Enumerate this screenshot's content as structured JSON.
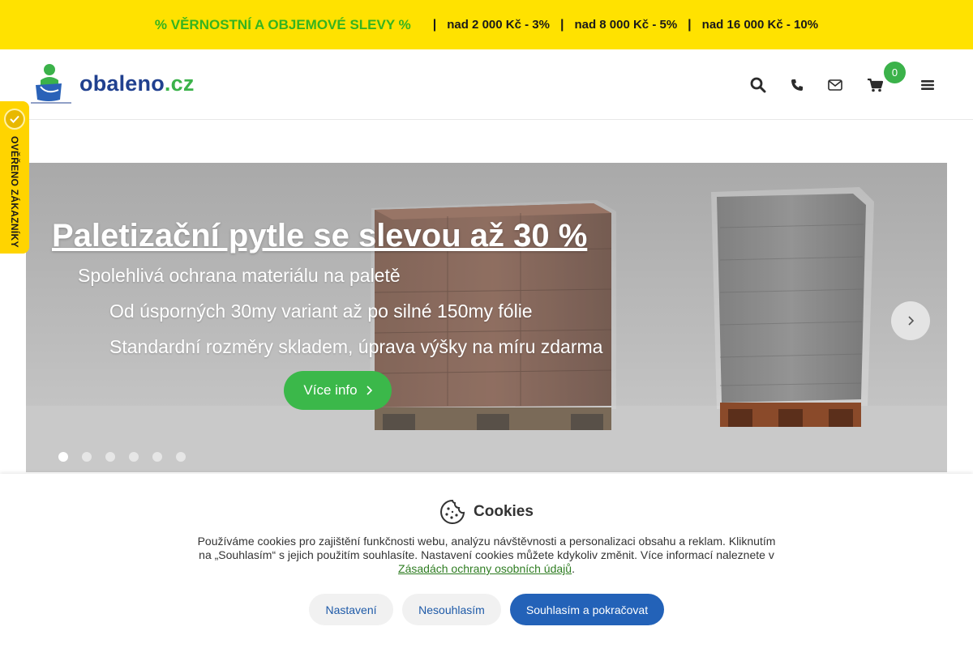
{
  "promo": {
    "lead": "% VĚRNOSTNÍ A OBJEMOVÉ SLEVY %",
    "separator": "|",
    "tiers": [
      "nad 2 000 Kč - 3%",
      "nad 8 000 Kč - 5%",
      "nad 16 000 Kč - 10%"
    ],
    "lead_color": "#35b41f",
    "background": "#ffe200"
  },
  "header": {
    "logo": {
      "name": "obaleno",
      "tld": ".cz"
    },
    "icons": [
      "search-icon",
      "phone-icon",
      "mail-icon",
      "cart-icon",
      "menu-icon"
    ],
    "cart_count": "0"
  },
  "verified_badge": {
    "label": "OVĚŘENO ZÁKAZNÍKY"
  },
  "hero": {
    "title": "Paletizační pytle se slevou až 30 %",
    "lines": [
      "Spolehlivá ochrana materiálu na paletě",
      "Od úsporných 30my variant až po silné 150my fólie",
      "Standardní rozměry skladem, úprava výšky na míru zdarma"
    ],
    "cta_label": "Více info",
    "slides": 6,
    "active_slide": 1,
    "accent": "#3bb84a"
  },
  "cookies": {
    "title": "Cookies",
    "text": "Používáme cookies pro zajištění funkčnosti webu, analýzu návštěvnosti a personalizaci obsahu a reklam. Kliknutím na „Souhlasím“ s jejich použitím souhlasíte. Nastavení cookies můžete kdykoliv změnit. Více informací naleznete v",
    "link_label": "Zásadách ochrany osobních údajů",
    "link_suffix": ".",
    "buttons": {
      "settings": "Nastavení",
      "decline": "Nesouhlasím",
      "accept": "Souhlasím a pokračovat"
    },
    "primary_color": "#2362b8"
  }
}
